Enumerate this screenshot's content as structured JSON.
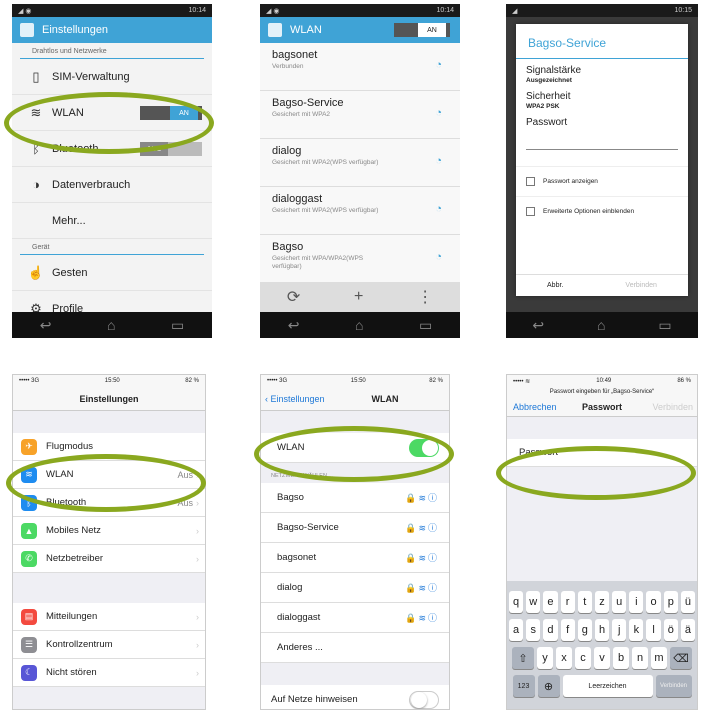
{
  "s1": {
    "status": "10:14",
    "title": "Einstellungen",
    "section1": "Drahtlos und Netzwerke",
    "items": [
      {
        "icon": "sim-icon",
        "label": "SIM-Verwaltung"
      },
      {
        "icon": "wifi-icon",
        "label": "WLAN",
        "toggle": "AN"
      },
      {
        "icon": "bluetooth-icon",
        "label": "Bluetooth",
        "toggle": "AUS"
      },
      {
        "icon": "data-usage-icon",
        "label": "Datenverbrauch"
      },
      {
        "icon": "",
        "label": "Mehr..."
      }
    ],
    "section2": "Gerät",
    "items2": [
      {
        "icon": "gesture-icon",
        "label": "Gesten"
      },
      {
        "icon": "profile-icon",
        "label": "Profile"
      }
    ]
  },
  "s2": {
    "status": "10:14",
    "title": "WLAN",
    "toggle": "AN",
    "networks": [
      {
        "name": "bagsonet",
        "sub": "Verbunden"
      },
      {
        "name": "Bagso-Service",
        "sub": "Gesichert mit WPA2"
      },
      {
        "name": "dialog",
        "sub": "Gesichert mit WPA2(WPS verfügbar)"
      },
      {
        "name": "dialoggast",
        "sub": "Gesichert mit WPA2(WPS verfügbar)"
      },
      {
        "name": "Bagso",
        "sub": "Gesichert mit WPA/WPA2(WPS verfügbar)"
      }
    ]
  },
  "s3": {
    "status": "10:15",
    "title": "Bagso-Service",
    "sig_label": "Signalstärke",
    "sig_val": "Ausgezeichnet",
    "sec_label": "Sicherheit",
    "sec_val": "WPA2 PSK",
    "pw_label": "Passwort",
    "show_pw": "Passwort anzeigen",
    "advanced": "Erweiterte Optionen einblenden",
    "cancel": "Abbr.",
    "connect": "Verbinden"
  },
  "s4": {
    "carrier": "••••• 3G",
    "time": "15:50",
    "battery": "82 %",
    "title": "Einstellungen",
    "items": [
      {
        "label": "Flugmodus",
        "color": "#f7a229"
      },
      {
        "label": "WLAN",
        "value": "Aus",
        "color": "#1e8cf0"
      },
      {
        "label": "Bluetooth",
        "value": "Aus",
        "color": "#1e8cf0"
      },
      {
        "label": "Mobiles Netz",
        "color": "#4cd964"
      },
      {
        "label": "Netzbetreiber",
        "color": "#4cd964"
      }
    ],
    "items2": [
      {
        "label": "Mitteilungen",
        "color": "#f34a3f"
      },
      {
        "label": "Kontrollzentrum",
        "color": "#8e8e93"
      },
      {
        "label": "Nicht stören",
        "color": "#5856d6"
      }
    ]
  },
  "s5": {
    "carrier": "••••• 3G",
    "time": "15:50",
    "battery": "82 %",
    "back": "Einstellungen",
    "title": "WLAN",
    "wlan": "WLAN",
    "section": "NETZWERK WÄHLEN ...",
    "networks": [
      "Bagso",
      "Bagso-Service",
      "bagsonet",
      "dialog",
      "dialoggast"
    ],
    "other": "Anderes ...",
    "ask": "Auf Netze hinweisen"
  },
  "s6": {
    "time": "10:49",
    "battery": "86 %",
    "prompt": "Passwort eingeben für „Bagso-Service“",
    "cancel": "Abbrechen",
    "title": "Passwort",
    "join": "Verbinden",
    "field": "Passwort",
    "row1": [
      "q",
      "w",
      "e",
      "r",
      "t",
      "z",
      "u",
      "i",
      "o",
      "p",
      "ü"
    ],
    "row2": [
      "a",
      "s",
      "d",
      "f",
      "g",
      "h",
      "j",
      "k",
      "l",
      "ö",
      "ä"
    ],
    "row3": [
      "y",
      "x",
      "c",
      "v",
      "b",
      "n",
      "m"
    ],
    "num": "123",
    "space": "Leerzeichen",
    "go": "Verbinden"
  }
}
